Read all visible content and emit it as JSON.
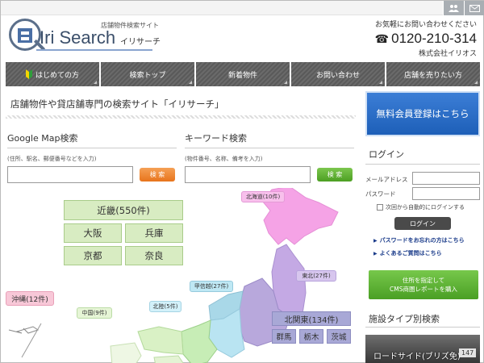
{
  "header": {
    "top_icons": [
      "users-icon",
      "mail-icon"
    ],
    "logo": {
      "tagline": "店舗物件検索サイト",
      "title": "Iri Search",
      "kana": "イリサーチ"
    },
    "contact": {
      "note": "お気軽にお問い合わせください",
      "phone": "0120-210-314",
      "company": "株式会社イリオス"
    }
  },
  "nav": {
    "items": [
      {
        "label": "はじめての方"
      },
      {
        "label": "検索トップ"
      },
      {
        "label": "新着物件"
      },
      {
        "label": "お問い合わせ"
      },
      {
        "label": "店舗を売りたい方"
      }
    ]
  },
  "main": {
    "page_title": "店舗物件や貸店舗専門の検索サイト「イリサーチ」",
    "google_search": {
      "heading": "Google Map検索",
      "hint": "(住所、駅名、郵便番号などを入力)",
      "value": "",
      "button": "検 索"
    },
    "keyword_search": {
      "heading": "キーワード検索",
      "hint": "(物件番号、名称、備考を入力)",
      "value": "",
      "button": "検 索"
    },
    "map": {
      "kinki": {
        "label": "近畿(550件)",
        "prefs": [
          "大阪",
          "兵庫",
          "京都",
          "奈良"
        ]
      },
      "okinawa": "沖縄(12件)",
      "hokkaido": "北海道(10件)",
      "tohoku": "東北(27件)",
      "koshinetsu": "甲信越(27件)",
      "hokuriku": "北陸(5件)",
      "chugoku": "中国(9件)",
      "kitakanto": {
        "label": "北関東(134件)",
        "prefs": [
          "群馬",
          "栃木",
          "茨城"
        ]
      }
    }
  },
  "sidebar": {
    "register_button": "無料会員登録はこちら",
    "login": {
      "heading": "ログイン",
      "email_label": "メールアドレス",
      "password_label": "パスワード",
      "remember_label": "次回から自動的にログインする",
      "button": "ログイン",
      "forgot_link": "パスワードをお忘れの方はこちら",
      "faq_link": "よくあるご質問はこちら"
    },
    "report_button": {
      "line1": "住所を指定して",
      "line2": "CMS商圏レポートを購入"
    },
    "facility": {
      "heading": "施設タイプ別検索",
      "card_label": "ロードサイド(ブリズ免)",
      "card_count": "147"
    }
  },
  "colors": {
    "nav_bg": "#5f5f5f",
    "accent_blue": "#2a6ac7",
    "accent_green": "#5aad2f",
    "accent_orange": "#ee8330",
    "hokkaido_pink": "#f6a6e8",
    "kanto_purple": "#b2a4dc",
    "kinki_green": "#d8ecc2"
  }
}
